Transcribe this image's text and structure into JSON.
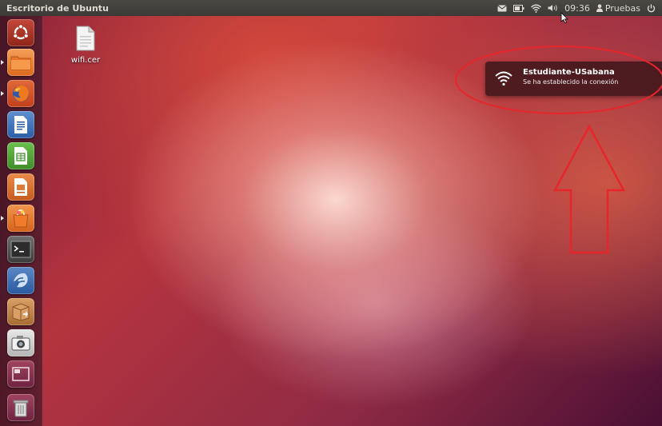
{
  "top_panel": {
    "window_title": "Escritorio de Ubuntu",
    "indicators": [
      "mail-icon",
      "battery-icon",
      "wifi-icon",
      "volume-icon"
    ],
    "clock": "09:36",
    "user": "Pruebas",
    "power_icon": "power-icon"
  },
  "launcher": {
    "items": [
      {
        "name": "dash-home",
        "icon": "ubuntu-logo-icon"
      },
      {
        "name": "home-folder",
        "icon": "folder-icon"
      },
      {
        "name": "firefox",
        "icon": "firefox-icon"
      },
      {
        "name": "libreoffice-writer",
        "icon": "writer-icon"
      },
      {
        "name": "libreoffice-calc",
        "icon": "calc-icon"
      },
      {
        "name": "libreoffice-impress",
        "icon": "impress-icon"
      },
      {
        "name": "software-center",
        "icon": "shopping-bag-icon"
      },
      {
        "name": "terminal",
        "icon": "terminal-icon"
      },
      {
        "name": "thunderbird",
        "icon": "thunderbird-icon"
      },
      {
        "name": "archive-manager",
        "icon": "package-icon"
      },
      {
        "name": "screenshot",
        "icon": "camera-icon"
      },
      {
        "name": "workspace-switcher",
        "icon": "workspace-icon"
      },
      {
        "name": "trash",
        "icon": "trash-icon"
      }
    ]
  },
  "desktop": {
    "file_label": "wifi.cer"
  },
  "notification": {
    "title": "Estudiante-USabana",
    "body": "Se ha establecido la conexión",
    "icon": "wifi-icon"
  },
  "colors": {
    "panel": "#3c3b37",
    "annotation_red": "#e8252b",
    "notification_bg": "#371419"
  }
}
